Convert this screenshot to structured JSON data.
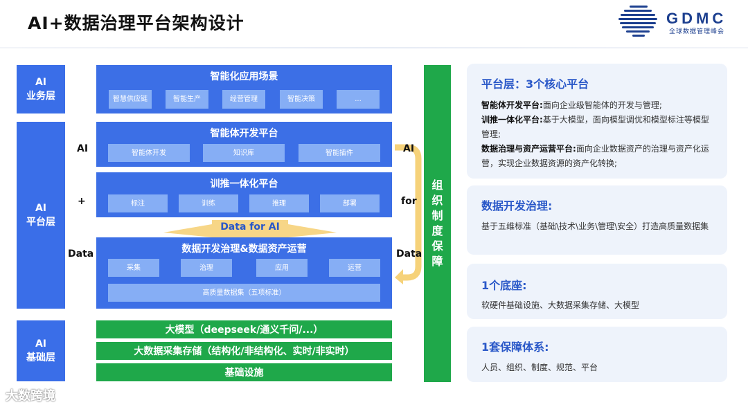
{
  "header": {
    "title": "AI+数据治理平台架构设计",
    "logo_text": "GDMC",
    "logo_sub": "全球数据管理峰会"
  },
  "layers": {
    "business": [
      "AI",
      "业务层"
    ],
    "platform": [
      "AI",
      "平台层"
    ],
    "foundation": [
      "AI",
      "基础层"
    ]
  },
  "app_scenarios": {
    "title": "智能化应用场景",
    "items": [
      "智慧供应链",
      "智能生产",
      "经营管理",
      "智能决策",
      "..."
    ]
  },
  "agent_platform": {
    "title": "智能体开发平台",
    "items": [
      "智能体开发",
      "知识库",
      "智能插件"
    ]
  },
  "training_platform": {
    "title": "训推一体化平台",
    "items": [
      "标注",
      "训练",
      "推理",
      "部署"
    ]
  },
  "data_for_ai": "Data  for  AI",
  "data_platform": {
    "title": "数据开发治理&数据资产运营",
    "items": [
      "采集",
      "治理",
      "应用",
      "运营"
    ],
    "dataset": "高质量数据集（五项标准）"
  },
  "mid_labels": {
    "ai": "AI",
    "plus": "+",
    "data": "Data"
  },
  "right_labels": {
    "ai": "AI",
    "for": "for",
    "data": "Data"
  },
  "foundation": {
    "model": "大模型（deepseek/通义千问/...）",
    "storage": "大数据采集存储（结构化/非结构化、实时/非实时）",
    "infra": "基础设施"
  },
  "governance_column": [
    "组",
    "织",
    "制",
    "度",
    "保",
    "障"
  ],
  "cards": [
    {
      "head": "平台层：3个核心平台",
      "lines": [
        {
          "bold": "智能体开发平台:",
          "text": "面向企业级智能体的开发与管理;"
        },
        {
          "bold": "训推一体化平台:",
          "text": "基于大模型，面向模型调优和模型标注等模型管理;"
        },
        {
          "bold": "数据治理与资产运营平台:",
          "text": "面向企业数据资产的治理与资产化运营，实现企业数据资源的资产化转换;"
        }
      ]
    },
    {
      "head": "数据开发治理:",
      "body": "基于五维标准（基础\\技术\\业务\\管理\\安全）打造高质量数据集"
    },
    {
      "head": "1个底座:",
      "body": "软硬件基础设施、大数据采集存储、大模型"
    },
    {
      "head": "1套保障体系:",
      "body": "人员、组织、制度、规范、平台"
    }
  ],
  "watermark": "大数跨境",
  "colors": {
    "blue": "#3c6fe6",
    "chip": "#86aef5",
    "green": "#1fa84a",
    "arrow": "#f6d27a",
    "accent": "#2a58c8"
  }
}
